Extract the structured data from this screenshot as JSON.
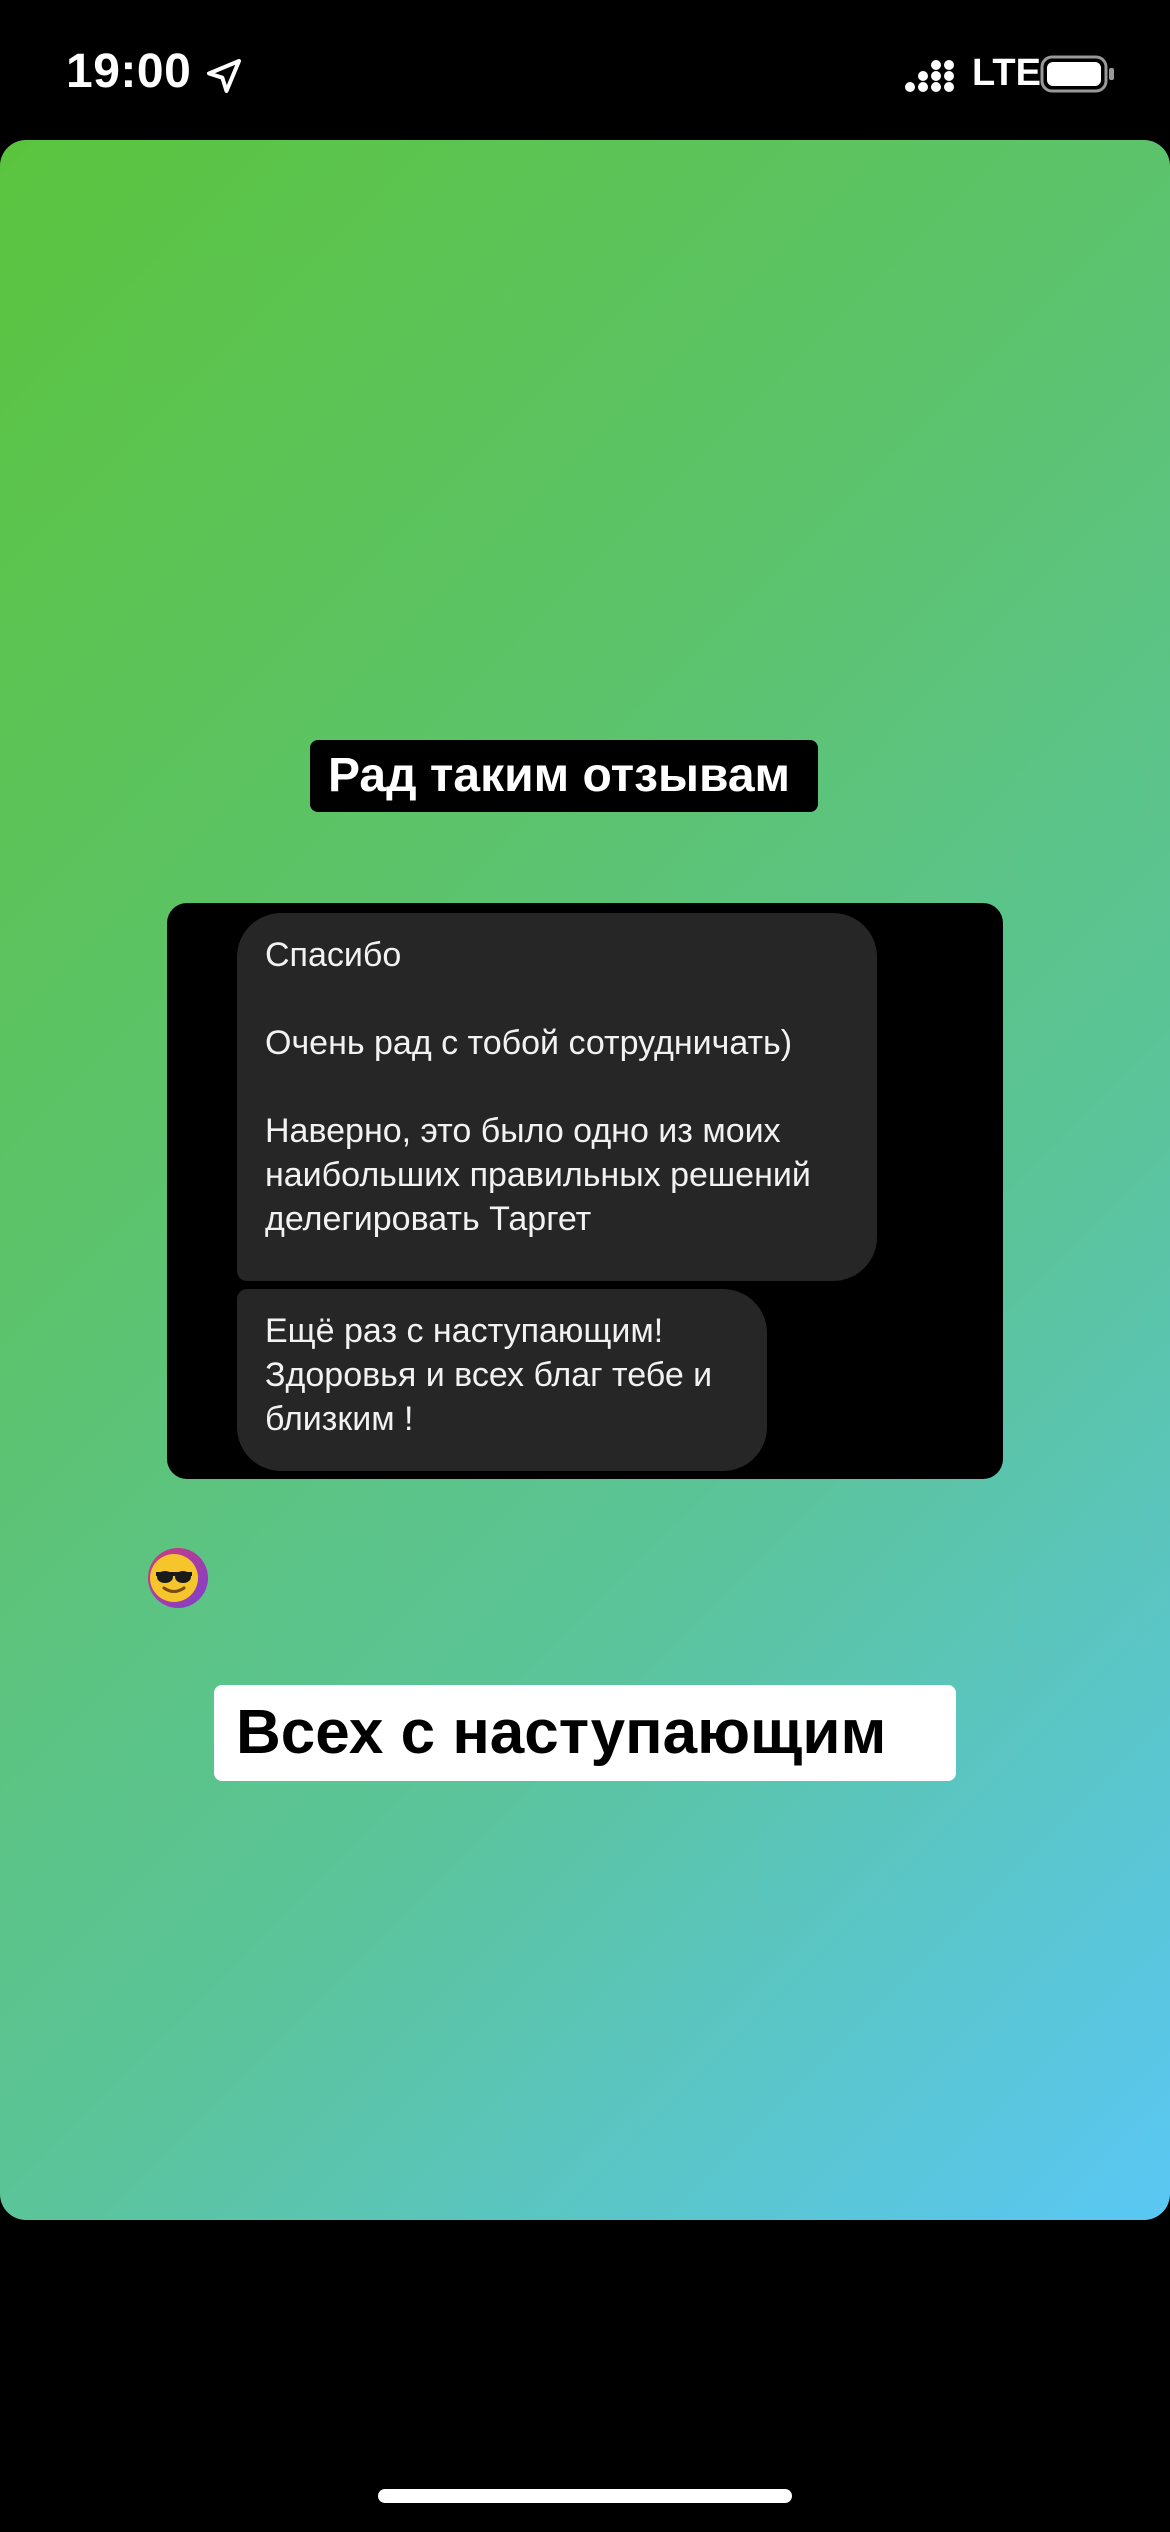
{
  "status_bar": {
    "time": "19:00",
    "network": "LTE",
    "icons": [
      "location-arrow-icon",
      "signal-icon",
      "battery-icon"
    ]
  },
  "story": {
    "gradient_colors": [
      "#5bc43e",
      "#5ac7f5"
    ],
    "sticker_top": "Рад таким отзывам",
    "sticker_bottom": "Всех с наступающим",
    "messages": [
      {
        "text": "Спасибо\n\nОчень рад с тобой сотрудничать)\n\nНаверно, это было одно из моих наибольших правильных решений делегировать Таргет"
      },
      {
        "text": "Ещё раз с наступающим!\nЗдоровья и всех благ тебе и близким !"
      }
    ],
    "avatar_icon": "sunglasses-emoji-avatar"
  }
}
